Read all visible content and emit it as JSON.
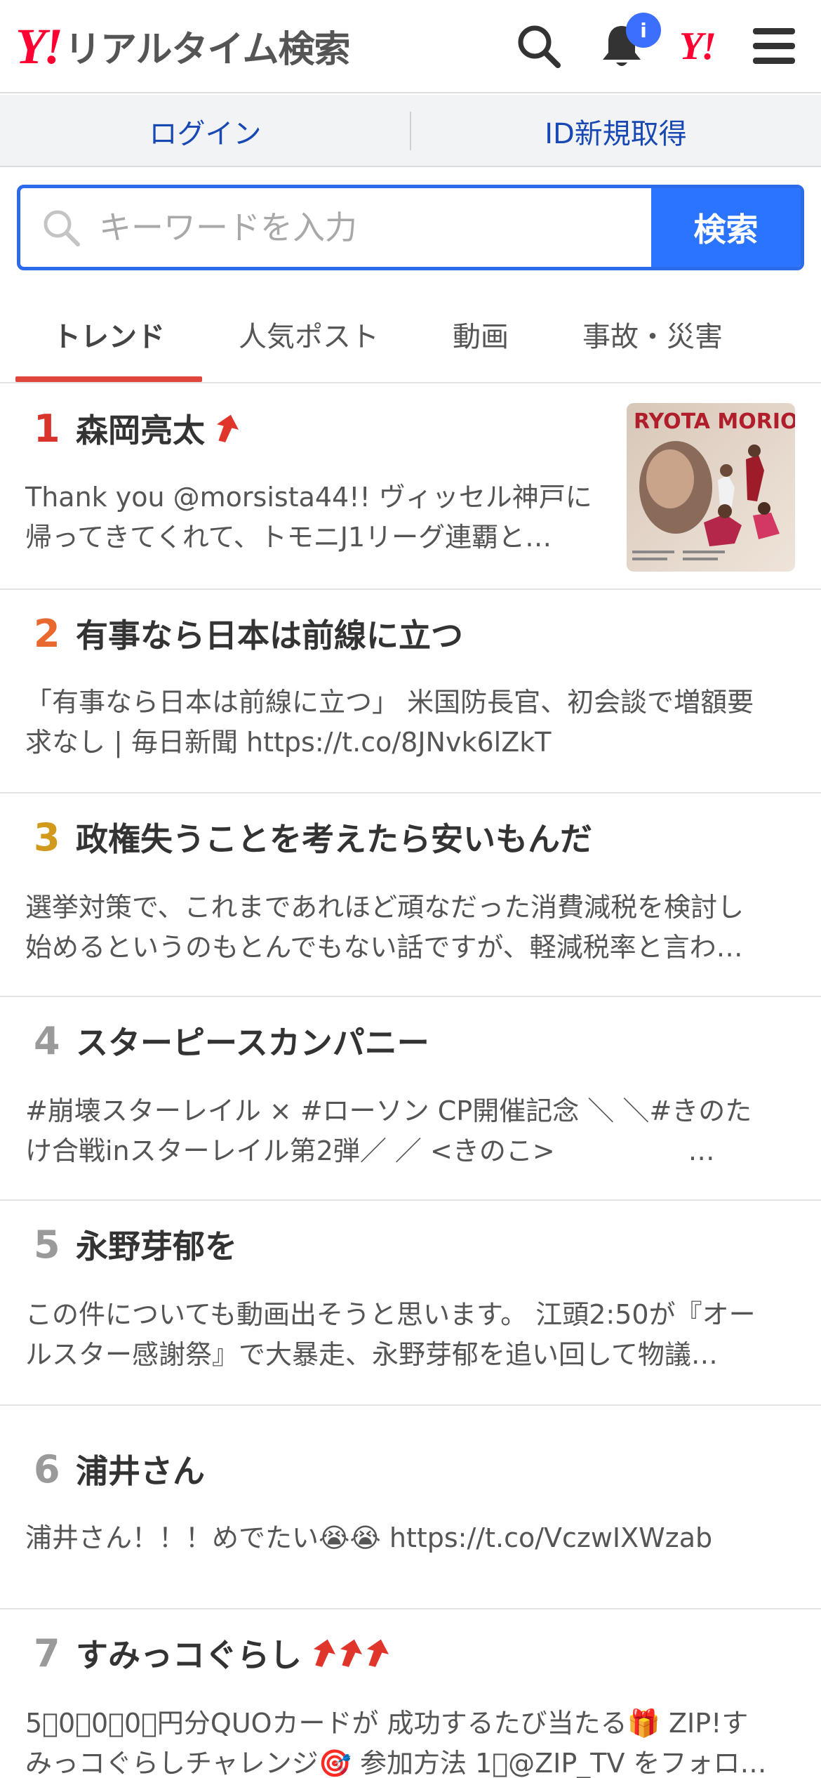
{
  "header": {
    "logo_mark": "Y!",
    "logo_text": "リアルタイム検索",
    "notification_badge": "i",
    "yahoo_mark": "Y!"
  },
  "account": {
    "login_label": "ログイン",
    "signup_label": "ID新規取得"
  },
  "search": {
    "placeholder": "キーワードを入力",
    "button_label": "検索"
  },
  "tabs": [
    {
      "label": "トレンド",
      "active": true
    },
    {
      "label": "人気ポスト",
      "active": false
    },
    {
      "label": "動画",
      "active": false
    },
    {
      "label": "事故・災害",
      "active": false
    }
  ],
  "trends": [
    {
      "rank": "1",
      "rank_color": "#d9342b",
      "title": "森岡亮太",
      "arrows": 1,
      "desc": "Thank you @morsista44!! ヴィッセル神戸に帰ってきてくれて、トモニJ1リーグ連覇と…",
      "thumb_text": "RYOTA MORIOKA"
    },
    {
      "rank": "2",
      "rank_color": "#e8682e",
      "title": "有事なら日本は前線に立つ",
      "arrows": 0,
      "desc": "「有事なら日本は前線に立つ」 米国防長官、初会談で増額要求なし | 毎日新聞 https://t.co/8JNvk6lZkT"
    },
    {
      "rank": "3",
      "rank_color": "#d19a1d",
      "title": "政権失うことを考えたら安いもんだ",
      "arrows": 0,
      "desc": "選挙対策で、これまであれほど頑なだった消費減税を検討し始めるというのもとんでもない話ですが、軽減税率と言わ…"
    },
    {
      "rank": "4",
      "rank_color": "#9a9a9a",
      "title": "スターピースカンパニー",
      "arrows": 0,
      "desc": "#崩壊スターレイル × #ローソン CP開催記念 ＼ ＼#きのたけ合戦inスターレイル第2弾／ ／ <きのこ>　　　　　…"
    },
    {
      "rank": "5",
      "rank_color": "#9a9a9a",
      "title": "永野芽郁を",
      "arrows": 0,
      "desc": "この件についても動画出そうと思います。 江頭2:50が『オールスター感謝祭』で大暴走、永野芽郁を追い回して物議…"
    },
    {
      "rank": "6",
      "rank_color": "#9a9a9a",
      "title": "浦井さん",
      "arrows": 0,
      "desc": "浦井さん！！！めでたい😭😭 https://t.co/VczwIXWzab"
    },
    {
      "rank": "7",
      "rank_color": "#9a9a9a",
      "title": "すみっコぐらし",
      "arrows": 3,
      "desc": "5⃣0⃣0⃣0⃣円分QUOカードが 成功するたび当たる🎁 ZIP!すみっコぐらしチャレンジ🎯 参加方法 1⃣@ZIP_TV をフォロ…"
    }
  ],
  "colors": {
    "accent_blue": "#2b74ff",
    "tab_underline": "#e0463c",
    "arrow_red": "#e0352b",
    "link_blue": "#1848b3"
  }
}
